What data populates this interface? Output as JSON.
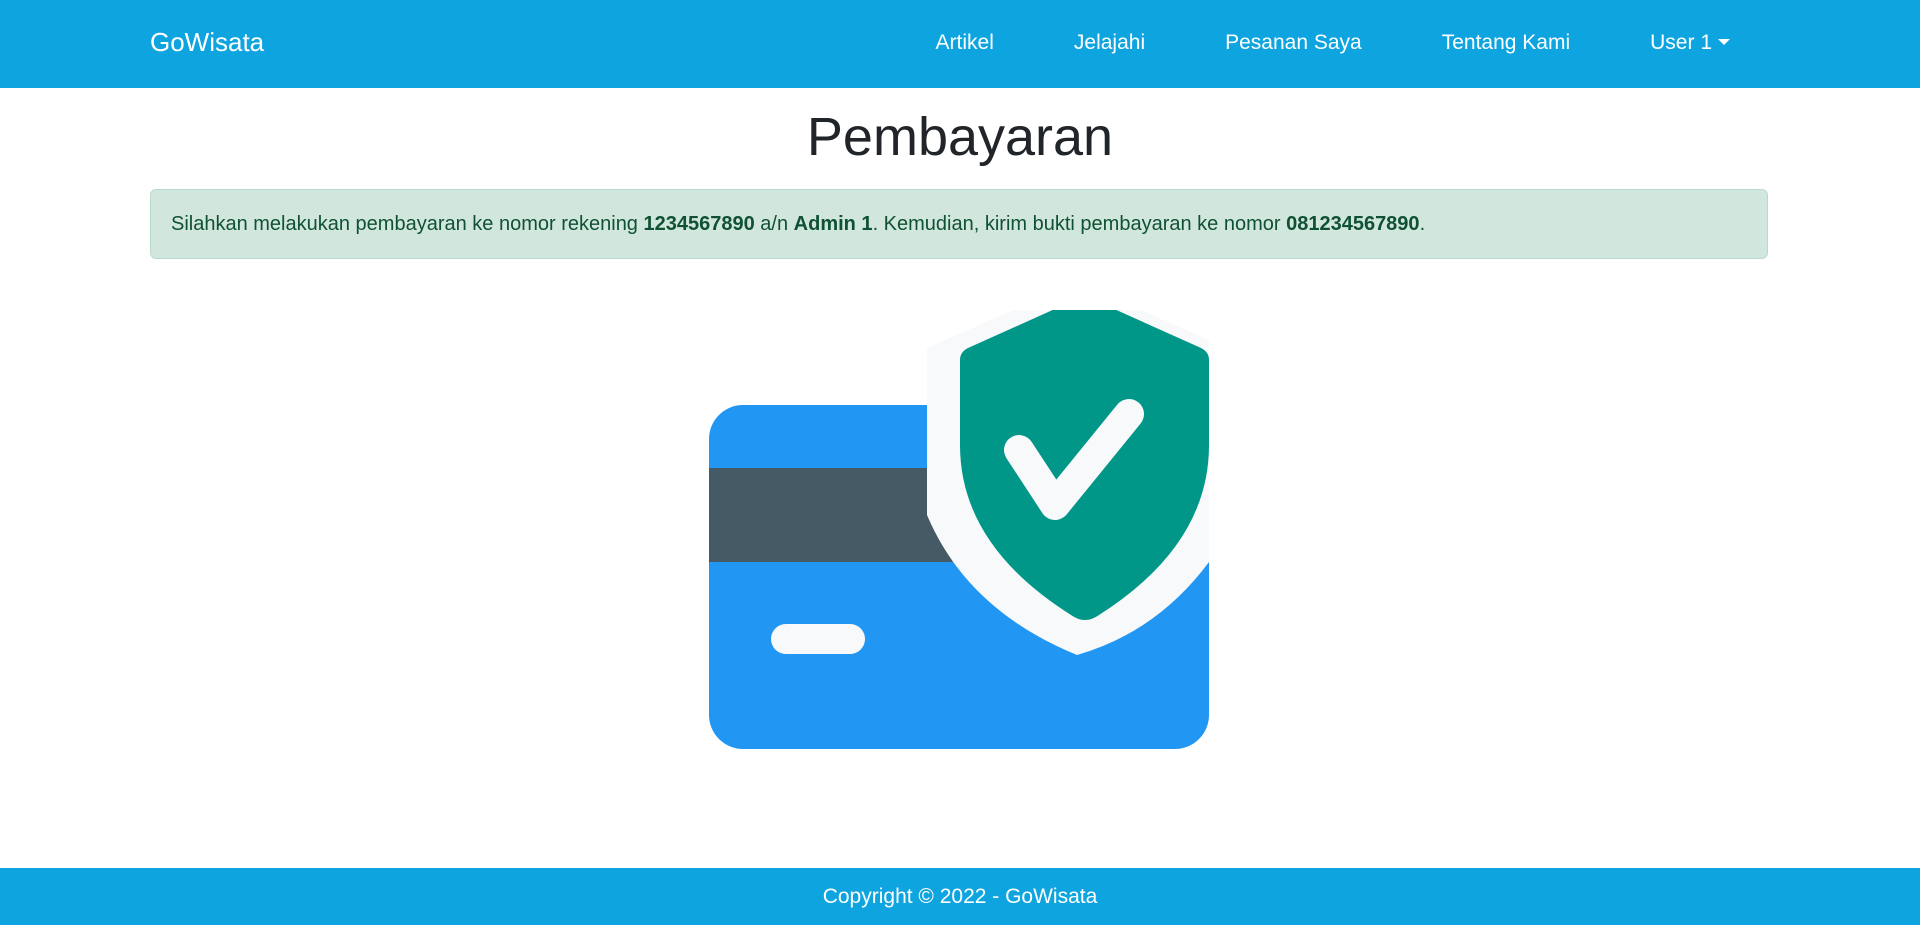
{
  "navbar": {
    "brand": "GoWisata",
    "links": [
      {
        "label": "Artikel"
      },
      {
        "label": "Jelajahi"
      },
      {
        "label": "Pesanan Saya"
      },
      {
        "label": "Tentang Kami"
      },
      {
        "label": "User 1"
      }
    ]
  },
  "main": {
    "title": "Pembayaran",
    "alert": {
      "text_1": "Silahkan melakukan pembayaran ke nomor rekening ",
      "account_number": "1234567890",
      "text_2": " a/n ",
      "account_name": "Admin 1",
      "text_3": ". Kemudian, kirim bukti pembayaran ke nomor ",
      "phone_number": "081234567890",
      "text_4": "."
    },
    "illustration_icon": "secure-payment-card-shield-icon"
  },
  "footer": {
    "copyright": "Copyright © 2022 - GoWisata"
  },
  "colors": {
    "navbar": "#0ea4df",
    "alert_bg": "#d1e7dd",
    "alert_text": "#0f5132",
    "card": "#2196f3",
    "card_stripe": "#455a64",
    "shield": "#009688",
    "highlight": "#f8f9fa"
  }
}
